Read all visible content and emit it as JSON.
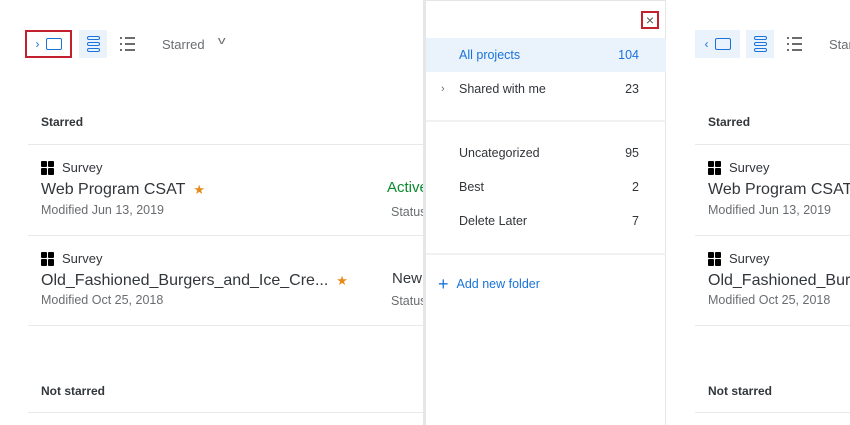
{
  "toolbar": {
    "filter_label": "Starred"
  },
  "sections": {
    "starred": "Starred",
    "not_starred": "Not starred"
  },
  "projects": [
    {
      "type": "Survey",
      "title": "Web Program CSAT",
      "modified": "Modified Jun 13, 2019",
      "status": "Active",
      "status_label": "Status",
      "status_color": "#0a8a2e",
      "starred": true
    },
    {
      "type": "Survey",
      "title": "Old_Fashioned_Burgers_and_Ice_Cre...",
      "modified": "Modified Oct 25, 2018",
      "status": "New",
      "status_label": "Status",
      "status_color": "#32363a",
      "starred": true
    }
  ],
  "sidebar": {
    "close_icon": "×",
    "items": [
      {
        "label": "All projects",
        "count": "104"
      },
      {
        "label": "Shared with me",
        "count": "23"
      },
      {
        "label": "Uncategorized",
        "count": "95"
      },
      {
        "label": "Best",
        "count": "2"
      },
      {
        "label": "Delete Later",
        "count": "7"
      }
    ],
    "add_folder": "Add new folder",
    "add_icon": "+"
  },
  "glyphs": {
    "star": "★",
    "chev_right": "›",
    "chev_left": "‹",
    "chev_down": "v",
    "expand": "›"
  }
}
